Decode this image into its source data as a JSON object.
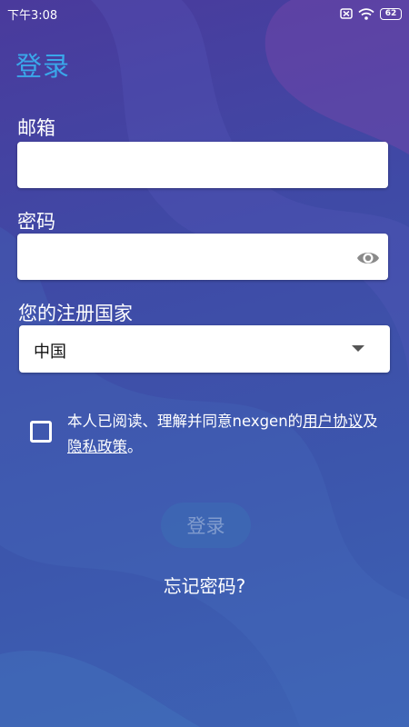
{
  "status_bar": {
    "time": "下午3:08",
    "battery": "62"
  },
  "page": {
    "title": "登录"
  },
  "email": {
    "label": "邮箱",
    "value": "",
    "placeholder": ""
  },
  "password": {
    "label": "密码",
    "value": "",
    "placeholder": ""
  },
  "country": {
    "label": "您的注册国家",
    "selected": "中国"
  },
  "agreement": {
    "text_before": "本人已阅读、理解并同意nexgen的",
    "user_agreement_link": "用户协议",
    "and_text": "及",
    "privacy_policy_link": "隐私政策",
    "suffix": "。",
    "checked": false
  },
  "login_button": {
    "label": "登录"
  },
  "forgot_password": {
    "label": "忘记密码?"
  },
  "colors": {
    "title": "#3aa7ea",
    "background": "#4045a6"
  }
}
